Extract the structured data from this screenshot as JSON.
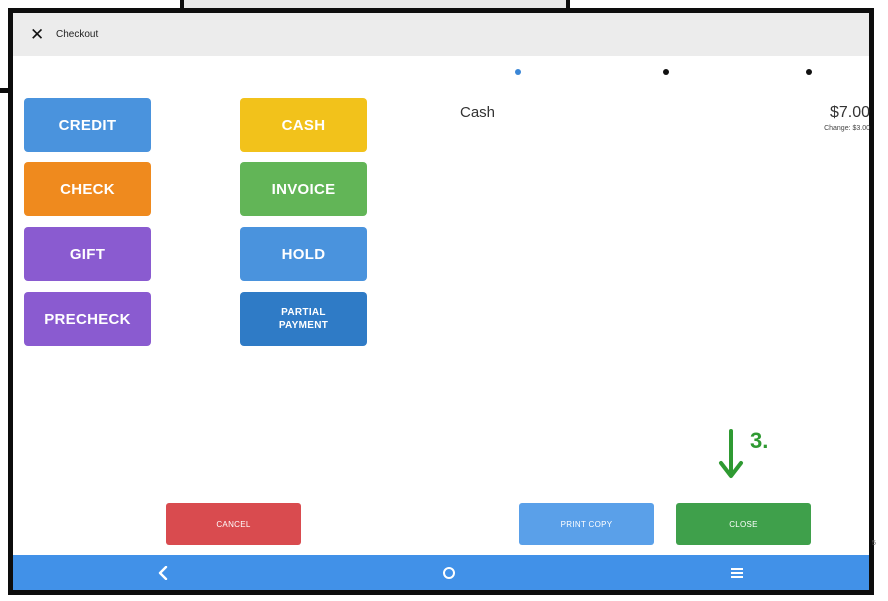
{
  "header": {
    "close_icon": "close-icon",
    "title": "Checkout"
  },
  "pager": {
    "count": 3,
    "active_index": 0,
    "active_color": "#3a86d6",
    "inactive_color": "#111111"
  },
  "payment_methods": [
    {
      "label": "CREDIT",
      "color": "#4a93dd"
    },
    {
      "label": "CASH",
      "color": "#f2c21b"
    },
    {
      "label": "CHECK",
      "color": "#ef8a1e"
    },
    {
      "label": "INVOICE",
      "color": "#62b557"
    },
    {
      "label": "GIFT",
      "color": "#8a5bd0"
    },
    {
      "label": "HOLD",
      "color": "#4a93dd"
    },
    {
      "label": "PRECHECK",
      "color": "#8a5bd0"
    },
    {
      "label": "PARTIAL\nPAYMENT",
      "color": "#2f7bc6"
    }
  ],
  "summary": {
    "method": "Cash",
    "amount": "$7.00",
    "change": "Change: $3.00"
  },
  "annotation": {
    "step": "3.",
    "color": "#2f9a32"
  },
  "actions": {
    "cancel": {
      "label": "CANCEL",
      "color": "#d94b4f"
    },
    "print": {
      "label": "PRINT COPY",
      "color": "#5aa0e9"
    },
    "close": {
      "label": "CLOSE",
      "color": "#3fa04b"
    }
  },
  "edge_text": "5",
  "navbar": {
    "back_icon": "back-chevron-icon",
    "home_icon": "home-circle-icon",
    "menu_icon": "menu-icon",
    "color": "#4191e8"
  }
}
